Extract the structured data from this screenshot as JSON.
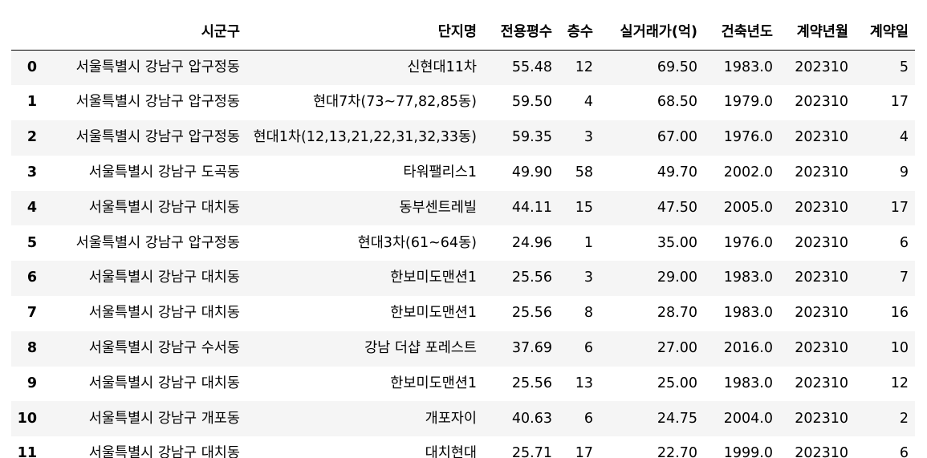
{
  "columns": [
    "",
    "시군구",
    "단지명",
    "전용평수",
    "층수",
    "실거래가(억)",
    "건축년도",
    "계약년월",
    "계약일"
  ],
  "rows": [
    {
      "idx": "0",
      "sigungu": "서울특별시 강남구 압구정동",
      "danji": "신현대11차",
      "area": "55.48",
      "floor": "12",
      "price": "69.50",
      "year": "1983.0",
      "ym": "202310",
      "day": "5"
    },
    {
      "idx": "1",
      "sigungu": "서울특별시 강남구 압구정동",
      "danji": "현대7차(73~77,82,85동)",
      "area": "59.50",
      "floor": "4",
      "price": "68.50",
      "year": "1979.0",
      "ym": "202310",
      "day": "17"
    },
    {
      "idx": "2",
      "sigungu": "서울특별시 강남구 압구정동",
      "danji": "현대1차(12,13,21,22,31,32,33동)",
      "area": "59.35",
      "floor": "3",
      "price": "67.00",
      "year": "1976.0",
      "ym": "202310",
      "day": "4"
    },
    {
      "idx": "3",
      "sigungu": "서울특별시 강남구 도곡동",
      "danji": "타워팰리스1",
      "area": "49.90",
      "floor": "58",
      "price": "49.70",
      "year": "2002.0",
      "ym": "202310",
      "day": "9"
    },
    {
      "idx": "4",
      "sigungu": "서울특별시 강남구 대치동",
      "danji": "동부센트레빌",
      "area": "44.11",
      "floor": "15",
      "price": "47.50",
      "year": "2005.0",
      "ym": "202310",
      "day": "17"
    },
    {
      "idx": "5",
      "sigungu": "서울특별시 강남구 압구정동",
      "danji": "현대3차(61~64동)",
      "area": "24.96",
      "floor": "1",
      "price": "35.00",
      "year": "1976.0",
      "ym": "202310",
      "day": "6"
    },
    {
      "idx": "6",
      "sigungu": "서울특별시 강남구 대치동",
      "danji": "한보미도맨션1",
      "area": "25.56",
      "floor": "3",
      "price": "29.00",
      "year": "1983.0",
      "ym": "202310",
      "day": "7"
    },
    {
      "idx": "7",
      "sigungu": "서울특별시 강남구 대치동",
      "danji": "한보미도맨션1",
      "area": "25.56",
      "floor": "8",
      "price": "28.70",
      "year": "1983.0",
      "ym": "202310",
      "day": "16"
    },
    {
      "idx": "8",
      "sigungu": "서울특별시 강남구 수서동",
      "danji": "강남 더샵 포레스트",
      "area": "37.69",
      "floor": "6",
      "price": "27.00",
      "year": "2016.0",
      "ym": "202310",
      "day": "10"
    },
    {
      "idx": "9",
      "sigungu": "서울특별시 강남구 대치동",
      "danji": "한보미도맨션1",
      "area": "25.56",
      "floor": "13",
      "price": "25.00",
      "year": "1983.0",
      "ym": "202310",
      "day": "12"
    },
    {
      "idx": "10",
      "sigungu": "서울특별시 강남구 개포동",
      "danji": "개포자이",
      "area": "40.63",
      "floor": "6",
      "price": "24.75",
      "year": "2004.0",
      "ym": "202310",
      "day": "2"
    },
    {
      "idx": "11",
      "sigungu": "서울특별시 강남구 대치동",
      "danji": "대치현대",
      "area": "25.71",
      "floor": "17",
      "price": "22.70",
      "year": "1999.0",
      "ym": "202310",
      "day": "6"
    }
  ]
}
